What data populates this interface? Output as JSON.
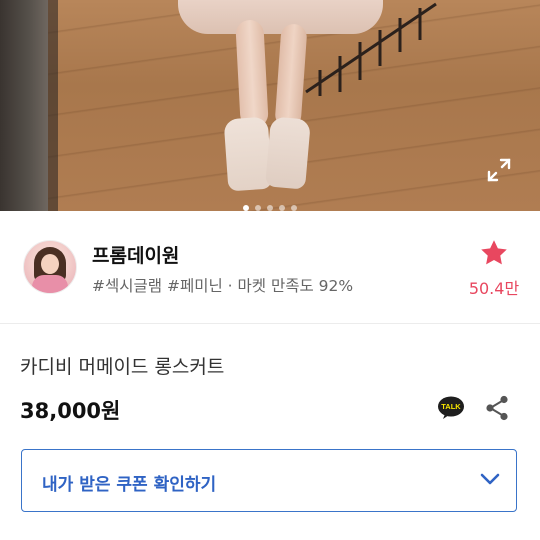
{
  "carousel": {
    "count": 5,
    "active_index": 0
  },
  "seller": {
    "name": "프롬데이원",
    "tags": "#섹시글램 #페미닌 · 마켓 만족도 92%",
    "favorite_count": "50.4만"
  },
  "product": {
    "title": "카디비 머메이드 롱스커트",
    "price": "38,000원"
  },
  "coupon": {
    "label": "내가 받은 쿠폰 확인하기"
  },
  "colors": {
    "accent_blue": "#2f63c4",
    "favorite_red": "#e8475f"
  },
  "icons": {
    "expand": "expand-icon",
    "favorite": "star-icon",
    "talk": "kakao-talk-icon",
    "share": "share-icon",
    "chevron": "chevron-down-icon"
  },
  "talk_badge": "TALK"
}
